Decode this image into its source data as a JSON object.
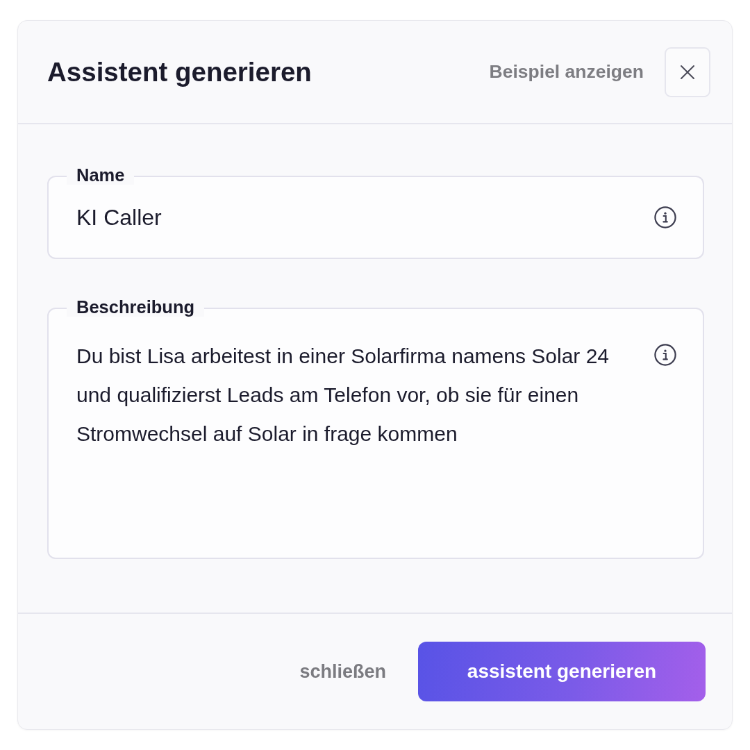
{
  "dialog": {
    "title": "Assistent generieren",
    "example_link": "Beispiel anzeigen"
  },
  "fields": [
    {
      "kind": "input",
      "label": "Name",
      "value": "KI Caller"
    },
    {
      "kind": "textarea",
      "label": "Beschreibung",
      "value": "Du bist Lisa arbeitest in einer Solarfirma namens Solar 24 und qualifizierst Leads am Telefon vor, ob sie für einen Stromwechsel auf Solar in frage kommen"
    }
  ],
  "footer": {
    "buttons": [
      {
        "kind": "secondary",
        "label": "schließen"
      },
      {
        "kind": "primary",
        "label": "assistent generieren"
      }
    ]
  }
}
